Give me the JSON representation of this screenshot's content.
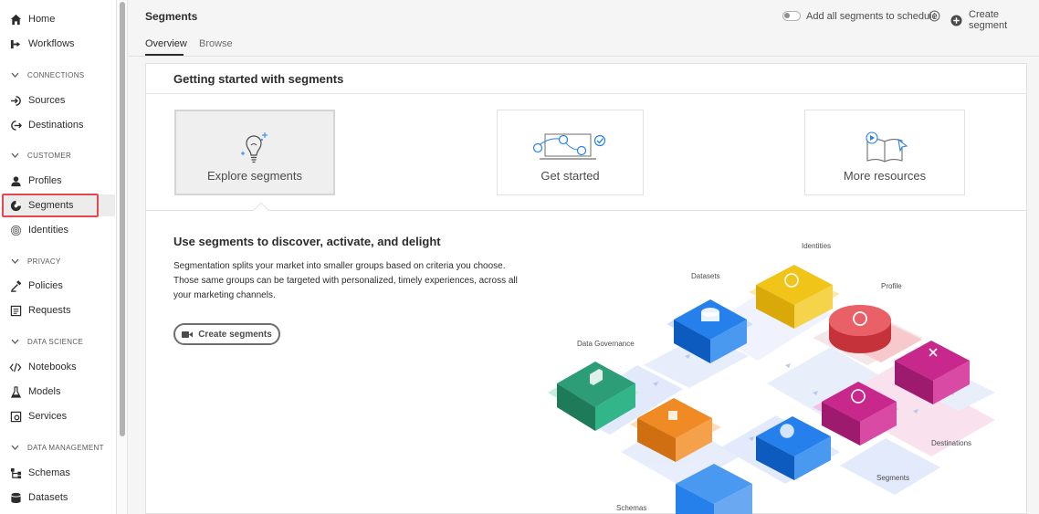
{
  "sidebar": {
    "items": [
      {
        "label": "Home",
        "icon": "home-icon"
      },
      {
        "label": "Workflows",
        "icon": "workflow-icon"
      },
      {
        "label": "Sources",
        "icon": "sources-icon"
      },
      {
        "label": "Destinations",
        "icon": "destinations-icon"
      },
      {
        "label": "Profiles",
        "icon": "profile-icon"
      },
      {
        "label": "Segments",
        "icon": "segments-icon"
      },
      {
        "label": "Identities",
        "icon": "fingerprint-icon"
      },
      {
        "label": "Policies",
        "icon": "policies-icon"
      },
      {
        "label": "Requests",
        "icon": "requests-icon"
      },
      {
        "label": "Notebooks",
        "icon": "code-icon"
      },
      {
        "label": "Models",
        "icon": "flask-icon"
      },
      {
        "label": "Services",
        "icon": "services-icon"
      },
      {
        "label": "Schemas",
        "icon": "schema-icon"
      },
      {
        "label": "Datasets",
        "icon": "database-icon"
      }
    ],
    "sections": [
      "CONNECTIONS",
      "CUSTOMER",
      "PRIVACY",
      "DATA SCIENCE",
      "DATA MANAGEMENT"
    ],
    "active_item": "Segments"
  },
  "header": {
    "title": "Segments",
    "schedule_toggle_label": "Add all segments to schedule",
    "schedule_toggle_on": false,
    "create_label": "Create segment",
    "tabs": [
      "Overview",
      "Browse"
    ],
    "active_tab": "Overview"
  },
  "main": {
    "card_title": "Getting started with segments",
    "tiles": [
      {
        "label": "Explore segments",
        "icon": "lightbulb-icon",
        "selected": true
      },
      {
        "label": "Get started",
        "icon": "steps-icon",
        "selected": false
      },
      {
        "label": "More resources",
        "icon": "book-icon",
        "selected": false
      }
    ],
    "headline": "Use segments to discover, activate, and delight",
    "description": "Segmentation splits your market into smaller groups based on criteria you choose. Those same groups can be targeted with personalized, timely experiences, across all your marketing channels.",
    "cta_label": "Create segments",
    "illustration_labels": {
      "identities": "Identities",
      "datasets": "Datasets",
      "profile": "Profile",
      "data_governance": "Data Governance",
      "destinations": "Destinations",
      "segments": "Segments",
      "schemas": "Schemas"
    }
  },
  "colors": {
    "accent_border": "#e34850",
    "text": "#2c2c2c",
    "illus_yellow": "#f0c419",
    "illus_blue": "#1473e6",
    "illus_red": "#e34850",
    "illus_green": "#2d9d78",
    "illus_magenta": "#c8288c",
    "illus_orange": "#f08a24"
  }
}
